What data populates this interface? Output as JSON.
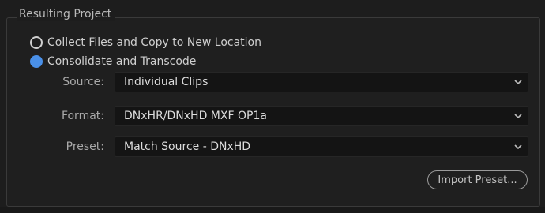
{
  "section": {
    "title": "Resulting Project"
  },
  "radios": [
    {
      "label": "Collect Files and Copy to New Location",
      "selected": false
    },
    {
      "label": "Consolidate and Transcode",
      "selected": true
    }
  ],
  "fields": {
    "source": {
      "label": "Source:",
      "value": "Individual Clips"
    },
    "format": {
      "label": "Format:",
      "value": "DNxHR/DNxHD MXF OP1a"
    },
    "preset": {
      "label": "Preset:",
      "value": "Match Source - DNxHD"
    }
  },
  "buttons": {
    "import_preset": "Import Preset..."
  },
  "colors": {
    "accent": "#4a90e8",
    "background": "#1d1d1d",
    "dropdown_bg": "#141414"
  },
  "icons": {
    "dropdown": "chevron-down-icon"
  }
}
